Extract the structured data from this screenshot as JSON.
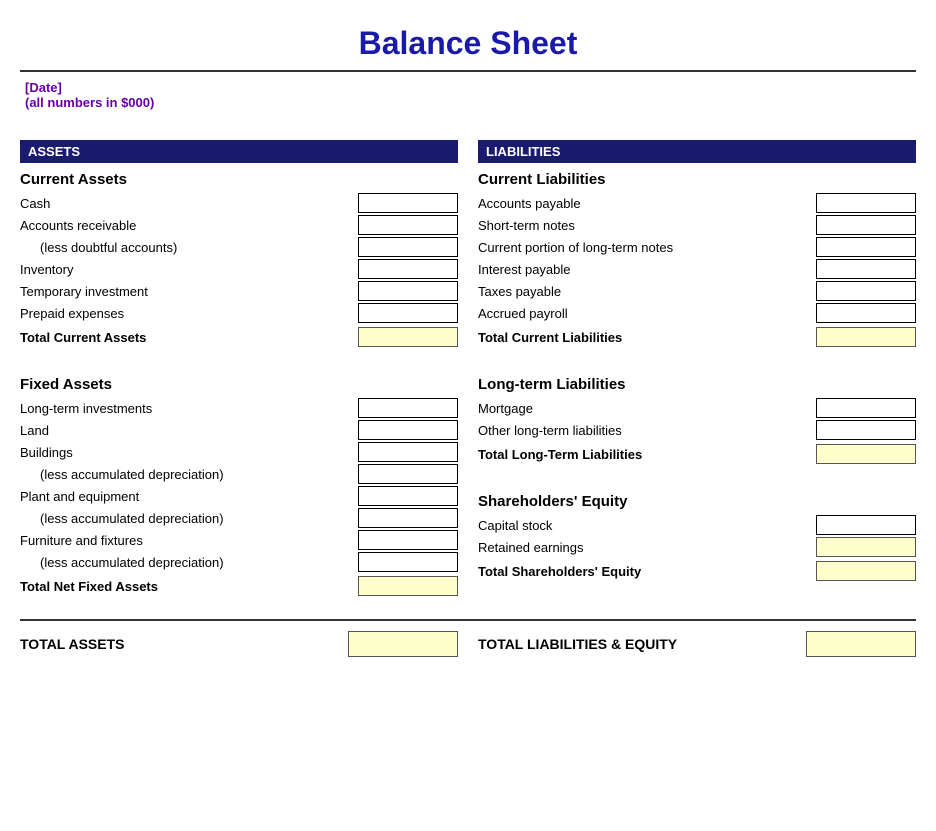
{
  "title": "Balance Sheet",
  "subtitle_line1": "[Date]",
  "subtitle_line2": "(all numbers in $000)",
  "assets": {
    "header": "ASSETS",
    "current_section_title": "Current Assets",
    "current_items": [
      "Cash",
      "Accounts receivable",
      "(less doubtful accounts)",
      "Inventory",
      "Temporary investment",
      "Prepaid expenses"
    ],
    "current_total_label": "Total Current Assets",
    "fixed_section_title": "Fixed Assets",
    "fixed_items": [
      "Long-term investments",
      "Land",
      "Buildings",
      "(less accumulated depreciation)",
      "Plant and equipment",
      "(less accumulated depreciation)",
      "Furniture and fixtures",
      "(less accumulated depreciation)"
    ],
    "fixed_total_label": "Total Net Fixed Assets",
    "total_label": "TOTAL ASSETS"
  },
  "liabilities": {
    "header": "LIABILITIES",
    "current_section_title": "Current Liabilities",
    "current_items": [
      "Accounts payable",
      "Short-term notes",
      "Current portion of long-term notes",
      "Interest payable",
      "Taxes payable",
      "Accrued payroll"
    ],
    "current_total_label": "Total Current Liabilities",
    "longterm_section_title": "Long-term Liabilities",
    "longterm_items": [
      "Mortgage",
      "Other long-term liabilities"
    ],
    "longterm_total_label": "Total Long-Term Liabilities",
    "equity_section_title": "Shareholders' Equity",
    "equity_items": [
      "Capital stock",
      "Retained earnings"
    ],
    "equity_total_label": "Total Shareholders' Equity",
    "total_label": "TOTAL LIABILITIES & EQUITY"
  }
}
